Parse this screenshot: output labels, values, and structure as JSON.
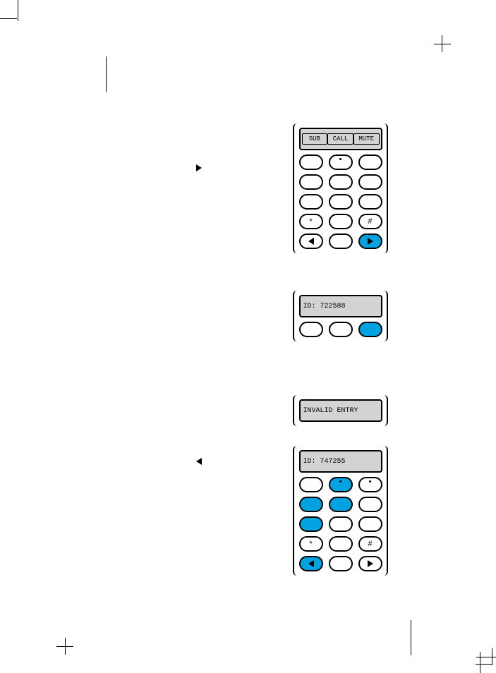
{
  "softkeys": {
    "left": "SUB",
    "center": "CALL",
    "right": "MUTE"
  },
  "keys": {
    "star": "*",
    "hash": "#"
  },
  "displays": {
    "panel2": "ID: 722588",
    "panel3": "INVALID ENTRY",
    "panel4": "ID: 747255"
  }
}
